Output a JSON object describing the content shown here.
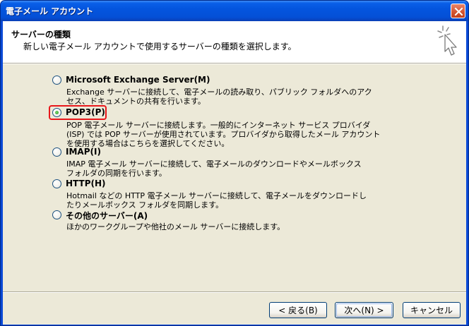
{
  "window": {
    "title": "電子メール アカウント"
  },
  "header": {
    "title": "サーバーの種類",
    "description": "新しい電子メール アカウントで使用するサーバーの種類を選択します。",
    "icon": "setup-sparkle-cursor-icon"
  },
  "options": [
    {
      "label": "Microsoft Exchange Server(M)",
      "checked": false,
      "desc1": "Exchange サーバーに接続して、電子メールの読み取り、パブリック フォルダへのアク",
      "desc2": "セス、ドキュメントの共有を行います。",
      "desc3": ""
    },
    {
      "label": "POP3(P)",
      "checked": true,
      "desc1": "POP 電子メール サーバーに接続します。一般的にインターネット サービス プロバイダ",
      "desc2": "(ISP) では POP サーバーが使用されています。プロバイダから取得したメール アカウント",
      "desc3": "を使用する場合はこちらを選択してください。"
    },
    {
      "label": "IMAP(I)",
      "checked": false,
      "desc1": "IMAP 電子メール サーバーに接続して、電子メールのダウンロードやメールボックス",
      "desc2": "フォルダの同期を行います。",
      "desc3": ""
    },
    {
      "label": "HTTP(H)",
      "checked": false,
      "desc1": "Hotmail などの HTTP 電子メール サーバーに接続して、電子メールをダウンロードし",
      "desc2": "たりメールボックス フォルダを同期します。",
      "desc3": ""
    },
    {
      "label": "その他のサーバー(A)",
      "checked": false,
      "desc1": "ほかのワークグループや他社のメール サーバーに接続します。",
      "desc2": "",
      "desc3": ""
    }
  ],
  "buttons": {
    "back": "< 戻る(B)",
    "next": "次へ(N) >",
    "cancel": "キャンセル"
  },
  "colors": {
    "highlight": "#e8171b",
    "titlebar": "#0455de",
    "dialog": "#ece9d8"
  }
}
